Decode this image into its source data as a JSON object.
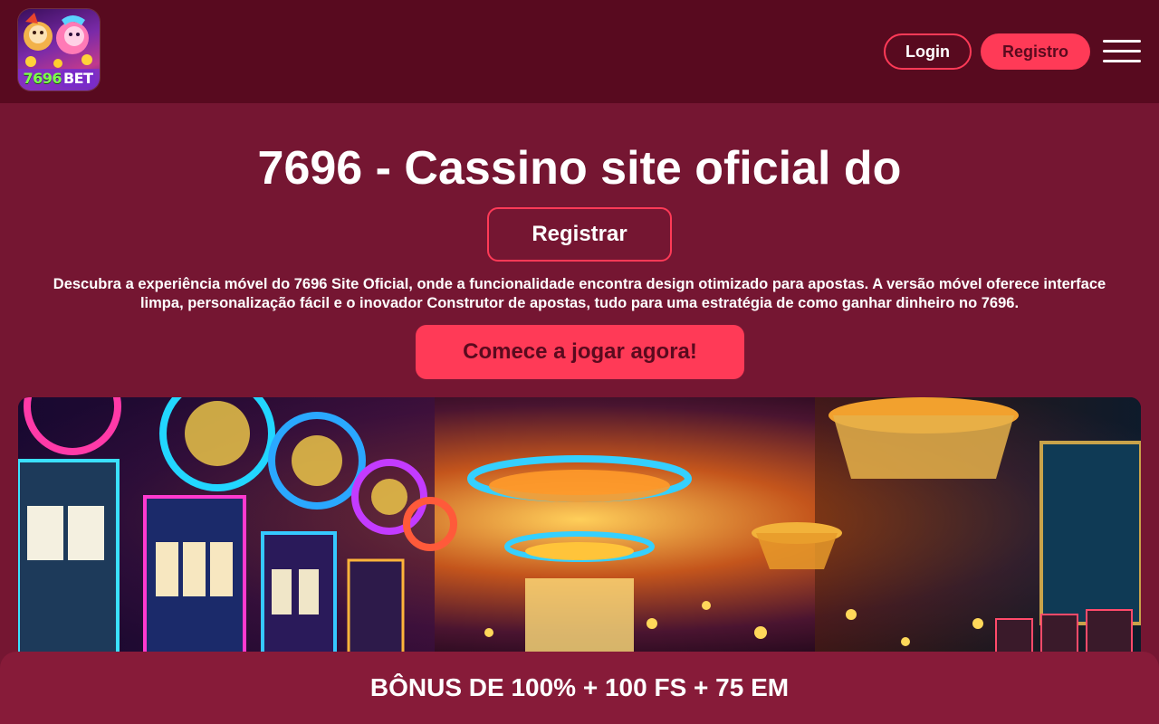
{
  "header": {
    "logo": {
      "number": "7696",
      "suffix": "BET"
    },
    "login_label": "Login",
    "registro_label": "Registro",
    "menu_icon": "hamburger-menu-icon"
  },
  "hero": {
    "title": "7696 - Cassino site oficial do",
    "register_label": "Registrar",
    "description": "Descubra a experiência móvel do 7696 Site Oficial, onde a funcionalidade encontra design otimizado para apostas. A versão móvel oferece interface limpa, personalização fácil e o inovador Construtor de apostas, tudo para uma estratégia de como ganhar dinheiro no 7696.",
    "cta_label": "Comece a jogar agora!"
  },
  "banner": {
    "image": "casino-interior-illustration"
  },
  "bonus_bar": {
    "text": "BÔNUS DE 100% + 100 FS + 75 EM"
  },
  "colors": {
    "page_bg": "#751632",
    "header_bg": "#580a1f",
    "accent": "#ff3a57",
    "accent_text": "#5a0a1e",
    "bonus_bg": "#871b39"
  }
}
